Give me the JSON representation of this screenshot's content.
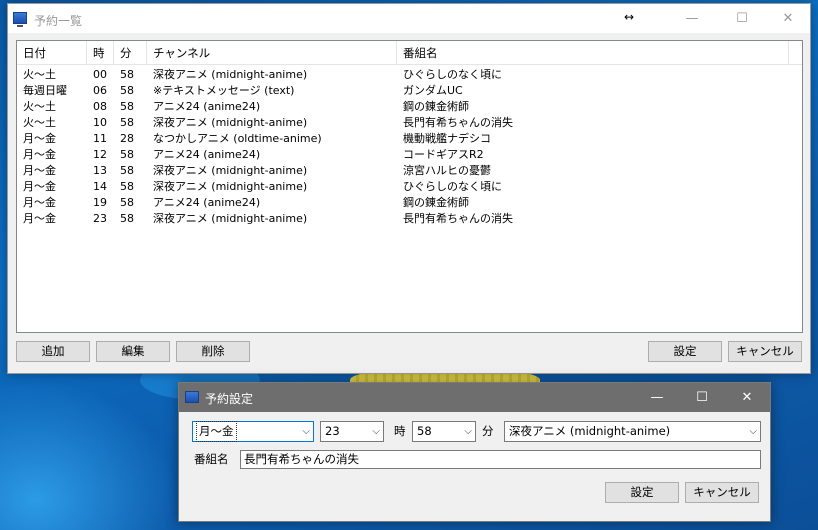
{
  "main_window": {
    "title": "予約一覧",
    "resize_indicator": "↔",
    "caption": {
      "minimize": "—",
      "maximize": "☐",
      "close": "✕"
    },
    "columns": [
      "日付",
      "時",
      "分",
      "チャンネル",
      "番組名"
    ],
    "rows": [
      [
        "火〜土",
        "00",
        "58",
        "深夜アニメ (midnight-anime)",
        "ひぐらしのなく頃に"
      ],
      [
        "毎週日曜",
        "06",
        "58",
        "※テキストメッセージ (text)",
        "ガンダムUC"
      ],
      [
        "火〜土",
        "08",
        "58",
        "アニメ24 (anime24)",
        "鋼の錬金術師"
      ],
      [
        "火〜土",
        "10",
        "58",
        "深夜アニメ (midnight-anime)",
        "長門有希ちゃんの消失"
      ],
      [
        "月〜金",
        "11",
        "28",
        "なつかしアニメ (oldtime-anime)",
        "機動戦艦ナデシコ"
      ],
      [
        "月〜金",
        "12",
        "58",
        "アニメ24 (anime24)",
        "コードギアスR2"
      ],
      [
        "月〜金",
        "13",
        "58",
        "深夜アニメ (midnight-anime)",
        "涼宮ハルヒの憂鬱"
      ],
      [
        "月〜金",
        "14",
        "58",
        "深夜アニメ (midnight-anime)",
        "ひぐらしのなく頃に"
      ],
      [
        "月〜金",
        "19",
        "58",
        "アニメ24 (anime24)",
        "鋼の錬金術師"
      ],
      [
        "月〜金",
        "23",
        "58",
        "深夜アニメ (midnight-anime)",
        "長門有希ちゃんの消失"
      ]
    ],
    "buttons": {
      "add": "追加",
      "edit": "編集",
      "delete": "削除",
      "settings": "設定",
      "cancel": "キャンセル"
    }
  },
  "dialog": {
    "title": "予約設定",
    "caption": {
      "minimize": "—",
      "maximize": "☐",
      "close": "✕"
    },
    "day_value": "月〜金",
    "hour_value": "23",
    "hour_label": "時",
    "minute_value": "58",
    "minute_label": "分",
    "channel_value": "深夜アニメ (midnight-anime)",
    "program_label": "番組名",
    "program_value": "長門有希ちゃんの消失",
    "buttons": {
      "settings": "設定",
      "cancel": "キャンセル"
    },
    "dropdown_arrow": "⌵"
  },
  "colors": {
    "accent": "#0078d7",
    "dialog_titlebar": "#6e6e6e",
    "desktop": "#0b6fc4"
  }
}
